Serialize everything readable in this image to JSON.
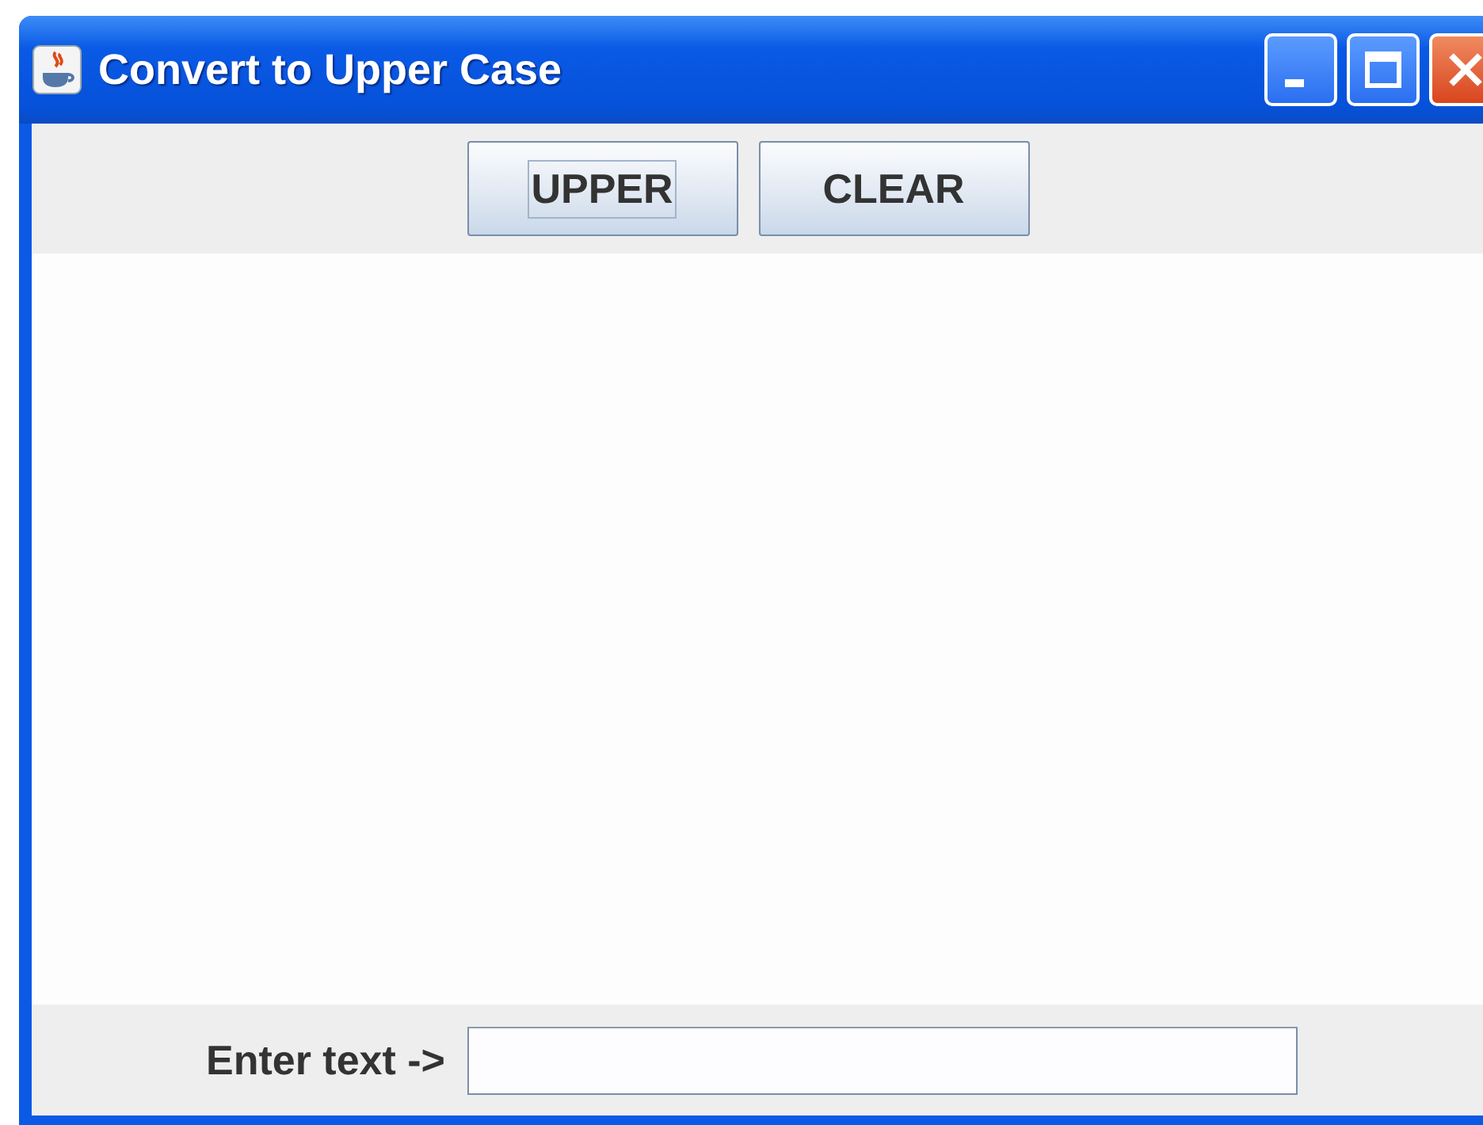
{
  "window": {
    "title": "Convert to Upper Case"
  },
  "buttons": [
    {
      "label": "UPPER",
      "focused": true
    },
    {
      "label": "CLEAR",
      "focused": false
    }
  ],
  "input": {
    "label": "Enter text ->"
  }
}
